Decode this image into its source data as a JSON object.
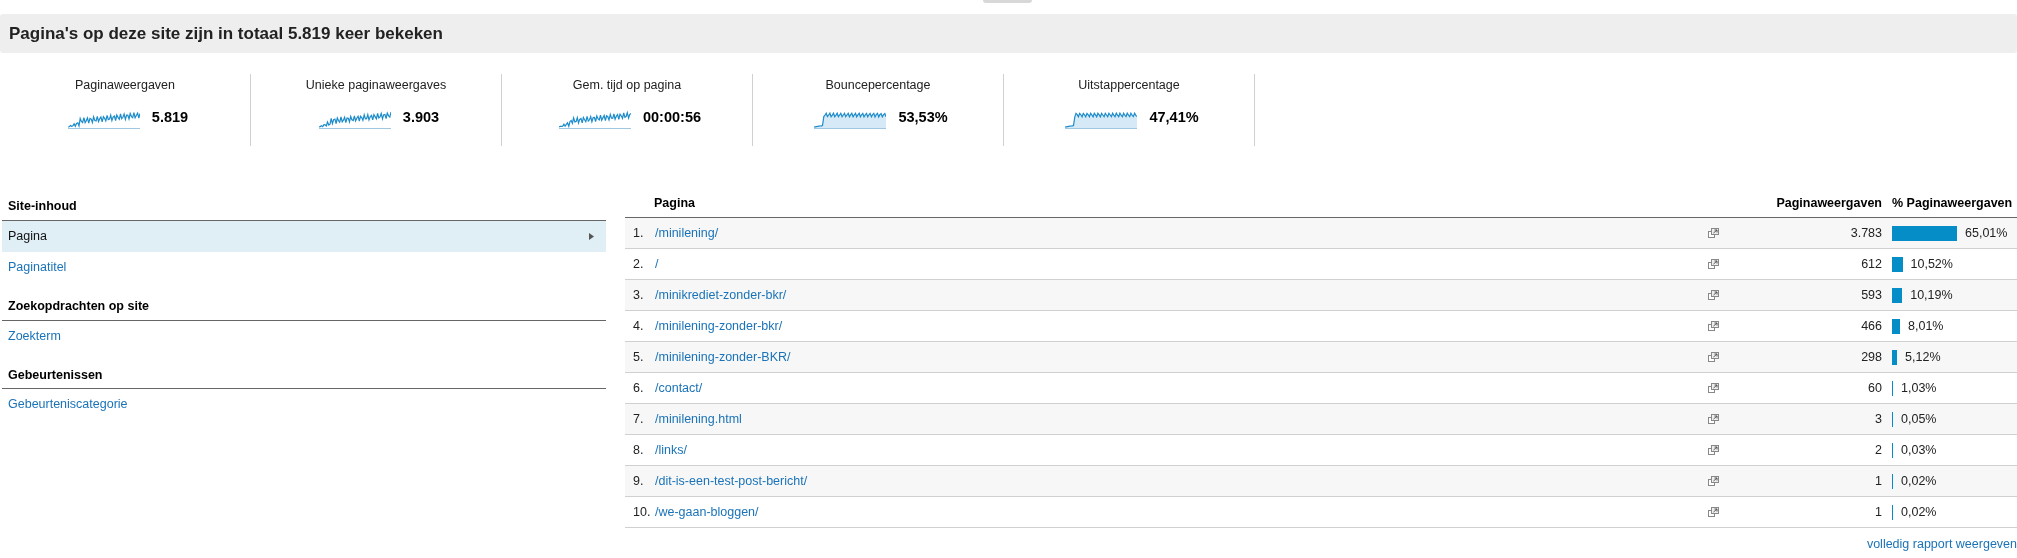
{
  "title": "Pagina's op deze site zijn in totaal 5.819 keer bekeken",
  "metrics": [
    {
      "label": "Paginaweergaven",
      "value": "5.819",
      "kind": "line"
    },
    {
      "label": "Unieke paginaweergaves",
      "value": "3.903",
      "kind": "line"
    },
    {
      "label": "Gem. tijd op pagina",
      "value": "00:00:56",
      "kind": "line"
    },
    {
      "label": "Bouncepercentage",
      "value": "53,53%",
      "kind": "area"
    },
    {
      "label": "Uitstappercentage",
      "value": "47,41%",
      "kind": "area"
    }
  ],
  "sidebar": {
    "sections": [
      {
        "heading": "Site-inhoud",
        "items": [
          {
            "label": "Pagina",
            "selected": true
          },
          {
            "label": "Paginatitel",
            "selected": false
          }
        ]
      },
      {
        "heading": "Zoekopdrachten op site",
        "items": [
          {
            "label": "Zoekterm",
            "selected": false
          }
        ]
      },
      {
        "heading": "Gebeurtenissen",
        "items": [
          {
            "label": "Gebeurteniscategorie",
            "selected": false
          }
        ]
      }
    ]
  },
  "table": {
    "columns": [
      "Pagina",
      "Paginaweergaven",
      "% Paginaweergaven"
    ],
    "rows": [
      {
        "rank": "1.",
        "page": "/minilening/",
        "views": "3.783",
        "percent": "65,01%"
      },
      {
        "rank": "2.",
        "page": "/",
        "views": "612",
        "percent": "10,52%"
      },
      {
        "rank": "3.",
        "page": "/minikrediet-zonder-bkr/",
        "views": "593",
        "percent": "10,19%"
      },
      {
        "rank": "4.",
        "page": "/minilening-zonder-bkr/",
        "views": "466",
        "percent": "8,01%"
      },
      {
        "rank": "5.",
        "page": "/minilening-zonder-BKR/",
        "views": "298",
        "percent": "5,12%"
      },
      {
        "rank": "6.",
        "page": "/contact/",
        "views": "60",
        "percent": "1,03%"
      },
      {
        "rank": "7.",
        "page": "/minilening.html",
        "views": "3",
        "percent": "0,05%"
      },
      {
        "rank": "8.",
        "page": "/links/",
        "views": "2",
        "percent": "0,03%"
      },
      {
        "rank": "9.",
        "page": "/dit-is-een-test-post-bericht/",
        "views": "1",
        "percent": "0,02%"
      },
      {
        "rank": "10.",
        "page": "/we-gaan-bloggen/",
        "views": "1",
        "percent": "0,02%"
      }
    ]
  },
  "footer_link": "volledig rapport weergeven"
}
